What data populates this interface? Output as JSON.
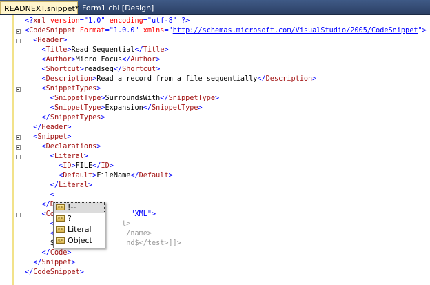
{
  "tabs": [
    {
      "label": "READNEXT.snippet*",
      "active": true
    },
    {
      "label": "Form1.cbl [Design]",
      "active": false
    }
  ],
  "code_lines": [
    "<?xml version=\"1.0\" encoding=\"utf-8\" ?>",
    "<CodeSnippet Format=\"1.0.0\" xmlns=\"http://schemas.microsoft.com/VisualStudio/2005/CodeSnippet\">",
    "  <Header>",
    "    <Title>Read Sequential</Title>",
    "    <Author>Micro Focus</Author>",
    "    <Shortcut>readseq</Shortcut>",
    "    <Description>Read a record from a file sequentially</Description>",
    "    <SnippetTypes>",
    "      <SnippetType>SurroundsWith</SnippetType>",
    "      <SnippetType>Expansion</SnippetType>",
    "    </SnippetTypes>",
    "  </Header>",
    "  <Snippet>",
    "    <Declarations>",
    "      <Literal>",
    "        <ID>FILE</ID>",
    "        <Default>FileName</Default>",
    "      </Literal>",
    "      <",
    "    </D",
    "    <Co",
    "      <",
    "      <",
    "      $",
    "    </Code>",
    "  </Snippet>",
    "</CodeSnippet>"
  ],
  "partial_hidden": {
    "l20": "\"XML\">",
    "l21": "t>",
    "l22": "/name>",
    "l23": "nd$</test>]]>"
  },
  "intellisense": {
    "items": [
      {
        "label": "!--",
        "icon": "xml-element-icon",
        "selected": true
      },
      {
        "label": "?",
        "icon": "xml-element-icon",
        "selected": false
      },
      {
        "label": "Literal",
        "icon": "xml-element-icon",
        "selected": false
      },
      {
        "label": "Object",
        "icon": "xml-element-icon",
        "selected": false
      }
    ]
  },
  "colors": {
    "tag": "#a31515",
    "attribute": "#ff0000",
    "delimiter": "#0000ff",
    "text": "#000000",
    "modified_bar": "#f2e28a"
  }
}
